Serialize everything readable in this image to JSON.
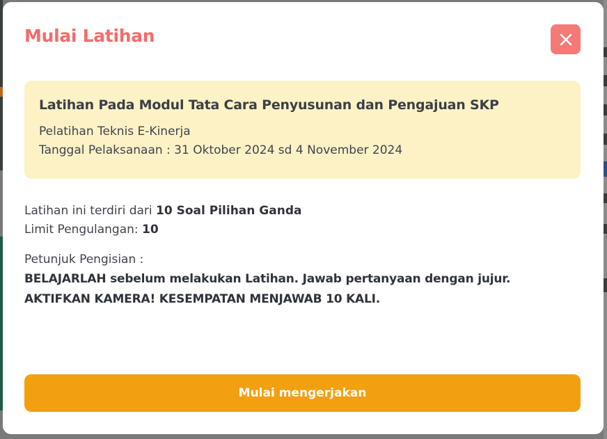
{
  "modal": {
    "title": "Mulai Latihan",
    "close_icon": "close-icon",
    "info": {
      "heading": "Latihan Pada Modul Tata Cara Penyusunan dan Pengajuan SKP",
      "training": "Pelatihan Teknis E-Kinerja",
      "date_line": "Tanggal Pelaksanaan : 31 Oktober 2024 sd 4 November 2024"
    },
    "details": {
      "intro_prefix": "Latihan ini terdiri dari ",
      "intro_bold": "10 Soal Pilihan Ganda",
      "limit_prefix": "Limit Pengulangan: ",
      "limit_value": "10",
      "instructions_label": "Petunjuk Pengisian :",
      "instruction_1": "BELAJARLAH sebelum melakukan Latihan. Jawab pertanyaan dengan jujur.",
      "instruction_2": "AKTIFKAN KAMERA! KESEMPATAN MENJAWAB 10 KALI."
    },
    "start_button": "Mulai mengerjakan"
  },
  "colors": {
    "title": "#f26d6b",
    "close_button": "#f47a78",
    "info_background": "#fdf2c6",
    "start_button": "#f29f10"
  }
}
